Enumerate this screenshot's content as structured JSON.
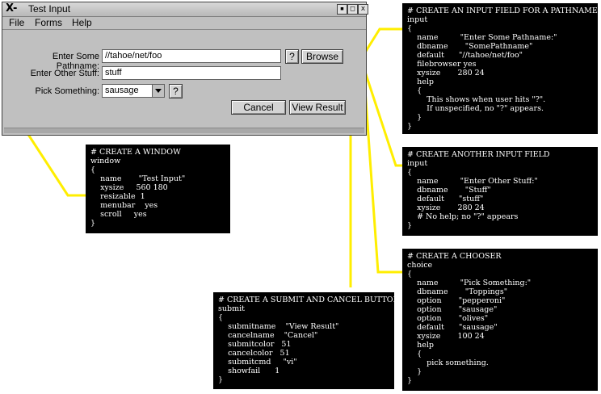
{
  "window": {
    "title": "Test Input",
    "logo_text": "X-",
    "controls": [
      "▪",
      "□",
      "x"
    ],
    "menu": [
      "File",
      "Forms",
      "Help"
    ],
    "fields": {
      "pathname": {
        "label": "Enter Some Pathname:",
        "value": "//tahoe/net/foo",
        "help_btn": "?",
        "browse_btn": "Browse"
      },
      "other": {
        "label": "Enter Other Stuff:",
        "value": "stuff"
      },
      "pick": {
        "label": "Pick Something:",
        "value": "sausage",
        "help_btn": "?"
      }
    },
    "buttons": {
      "cancel": "Cancel",
      "submit": "View Result"
    }
  },
  "colors": {
    "connector": "#ffee00",
    "panel_bg": "#000000",
    "panel_text": "#ffffff"
  },
  "panels": {
    "window_def": "# CREATE A WINDOW\nwindow\n{\n    name       \"Test Input\"\n    xysize     560 180\n    resizable  1\n    menubar    yes\n    scroll     yes\n}",
    "input_pathname": "# CREATE AN INPUT FIELD FOR A PATHNAME\ninput\n{\n    name         \"Enter Some Pathname:\"\n    dbname       \"SomePathname\"\n    default      \"//tahoe/net/foo\"\n    filebrowser yes\n    xysize       280 24\n    help\n    {\n        This shows when user hits \"?\".\n        If unspecified, no \"?\" appears.\n    }\n}",
    "input_other": "# CREATE ANOTHER INPUT FIELD\ninput\n{\n    name         \"Enter Other Stuff:\"\n    dbname       \"Stuff\"\n    default      \"stuff\"\n    xysize       280 24\n    # No help; no \"?\" appears\n}",
    "chooser": "# CREATE A CHOOSER\nchoice\n{\n    name         \"Pick Something:\"\n    dbname       \"Toppings\"\n    option       \"pepperoni\"\n    option       \"sausage\"\n    option       \"olives\"\n    default      \"sausage\"\n    xysize       100 24\n    help\n    {\n        pick something.\n    }\n}",
    "submit": "# CREATE A SUBMIT AND CANCEL BUTTON\nsubmit\n{\n    submitname    \"View Result\"\n    cancelname    \"Cancel\"\n    submitcolor   51\n    cancelcolor   51\n    submitcmd     \"vi\"\n    showfail      1\n}"
  }
}
